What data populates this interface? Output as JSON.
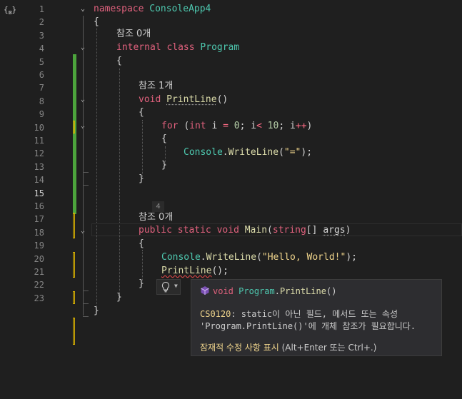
{
  "editor": {
    "line_numbers": [
      "1",
      "2",
      "3",
      "4",
      "5",
      "6",
      "7",
      "8",
      "9",
      "10",
      "11",
      "12",
      "13",
      "14",
      "15",
      "16",
      "17",
      "18",
      "19",
      "20",
      "21",
      "22",
      "23"
    ],
    "current_line": "15",
    "code_lens": {
      "refs_zero": "참조 0개",
      "refs_one": "참조 1개"
    },
    "tokens": {
      "namespace_kw": "namespace",
      "namespace_name": "ConsoleApp4",
      "open_brace": "{",
      "close_brace": "}",
      "internal_kw": "internal",
      "class_kw": "class",
      "class_name": "Program",
      "void_kw": "void",
      "printline_name": "PrintLine",
      "parens": "()",
      "for_kw": "for",
      "for_open": "(",
      "int_kw": "int",
      "for_var": " i ",
      "assign": "=",
      "zero": " 0",
      "semi_i": "; i",
      "lt": "<",
      "ten": " 10",
      "semi_inc": "; i",
      "inc": "++",
      "close_paren": ")",
      "console_type": "Console",
      "dot": ".",
      "writeline_name": "WriteLine",
      "paren_open": "(",
      "eq_string": "\"=\"",
      "paren_close_semi": ");",
      "public_kw": "public",
      "static_kw": "static",
      "main_name": "Main",
      "string_kw": "string",
      "array_brackets": "[] ",
      "args_param": "args",
      "hello_string": "\"Hello, World!\"",
      "call_suffix": "();"
    },
    "reference_badge": "4"
  },
  "quick_info": {
    "signature": {
      "void_kw": "void",
      "class_name": "Program",
      "dot": ".",
      "method_name": "PrintLine",
      "params": "()"
    },
    "error_code": "CS0120",
    "error_line1": ": static이 아닌 필드, 메서드 또는 속성",
    "error_line2": "'Program.PrintLine()'에 개체 참조가 필요합니다.",
    "fix_link": "잠재적 수정 사항 표시",
    "fix_hint": " (Alt+Enter 또는 Ctrl+.)"
  },
  "colors": {
    "background": "#1f1f1f",
    "keyword": "#e0617d",
    "type": "#4ec9b0",
    "method": "#dcdcaa",
    "string": "#f0d58c",
    "number": "#b5cea8",
    "saved_change": "#4ca43c",
    "unsaved_change": "#d8b000",
    "error_squiggle": "#f14c4c"
  },
  "icons": {
    "margin": "braces-icon",
    "fold": "chevron-down-icon",
    "lightbulb": "lightbulb-icon",
    "method": "method-cube-icon"
  }
}
